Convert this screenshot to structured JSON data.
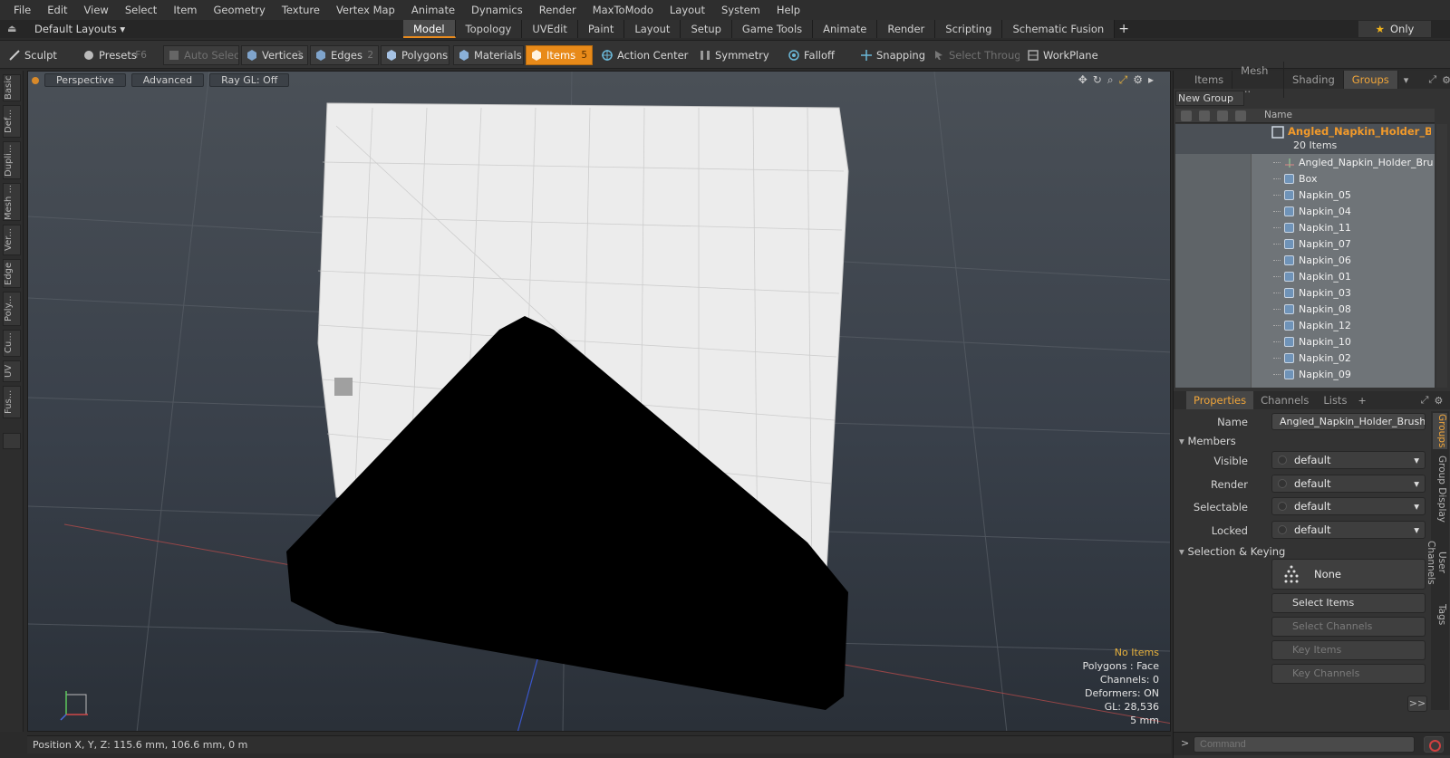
{
  "menu": [
    "File",
    "Edit",
    "View",
    "Select",
    "Item",
    "Geometry",
    "Texture",
    "Vertex Map",
    "Animate",
    "Dynamics",
    "Render",
    "MaxToModo",
    "Layout",
    "System",
    "Help"
  ],
  "layout_selector": "Default Layouts",
  "layout_tabs": [
    "Model",
    "Topology",
    "UVEdit",
    "Paint",
    "Layout",
    "Setup",
    "Game Tools",
    "Animate",
    "Render",
    "Scripting",
    "Schematic Fusion"
  ],
  "active_layout_tab": "Model",
  "only_label": "Only",
  "toolbar": {
    "sculpt": "Sculpt",
    "presets": "Presets",
    "presets_key": "F6",
    "auto_select": "Auto Select",
    "vertices": "Vertices",
    "vertices_key": "1",
    "edges": "Edges",
    "edges_key": "2",
    "polygons": "Polygons",
    "materials": "Materials",
    "items": "Items",
    "items_key": "5",
    "action_center": "Action Center",
    "symmetry": "Symmetry",
    "falloff": "Falloff",
    "snapping": "Snapping",
    "select_through": "Select Through",
    "workplane": "WorkPlane"
  },
  "left_tabs": [
    "Basic",
    "Def...",
    "Dupli...",
    "Mesh ...",
    "Ver...",
    "Edge",
    "Poly...",
    "Cu...",
    "UV",
    "Fus..."
  ],
  "viewport": {
    "tabs": [
      "Perspective",
      "Advanced",
      "Ray GL: Off"
    ],
    "stats": {
      "no_items": "No Items",
      "polygons": "Polygons : Face",
      "channels": "Channels: 0",
      "deformers": "Deformers: ON",
      "gl": "GL: 28,536",
      "scale": "5 mm"
    }
  },
  "status_bar": "Position X, Y, Z:   115.6 mm, 106.6 mm, 0 m",
  "right_panel": {
    "tabs": [
      "Items",
      "Mesh ...",
      "Shading",
      "Groups"
    ],
    "active_tab": "Groups",
    "new_group": "New Group",
    "name_header": "Name",
    "group_name": "Angled_Napkin_Holder_Br...",
    "group_count": "20 Items",
    "items": [
      "Angled_Napkin_Holder_Brus...",
      "Box",
      "Napkin_05",
      "Napkin_04",
      "Napkin_11",
      "Napkin_07",
      "Napkin_06",
      "Napkin_01",
      "Napkin_03",
      "Napkin_08",
      "Napkin_12",
      "Napkin_10",
      "Napkin_02",
      "Napkin_09"
    ]
  },
  "properties": {
    "tabs": [
      "Properties",
      "Channels",
      "Lists"
    ],
    "active_tab": "Properties",
    "name_label": "Name",
    "name_value": "Angled_Napkin_Holder_Brushed_",
    "members_section": "Members",
    "visible_label": "Visible",
    "visible_value": "default",
    "render_label": "Render",
    "render_value": "default",
    "selectable_label": "Selectable",
    "selectable_value": "default",
    "locked_label": "Locked",
    "locked_value": "default",
    "selection_section": "Selection & Keying",
    "none_label": "None",
    "select_items": "Select Items",
    "select_channels": "Select Channels",
    "key_items": "Key Items",
    "key_channels": "Key Channels",
    "more": ">>",
    "side_tabs": [
      "Groups",
      "Group Display",
      "User Channels",
      "Tags"
    ]
  },
  "command_placeholder": "Command",
  "colors": {
    "accent": "#e88a19",
    "group_name": "#f29a2a",
    "no_items": "#e8b23c"
  }
}
